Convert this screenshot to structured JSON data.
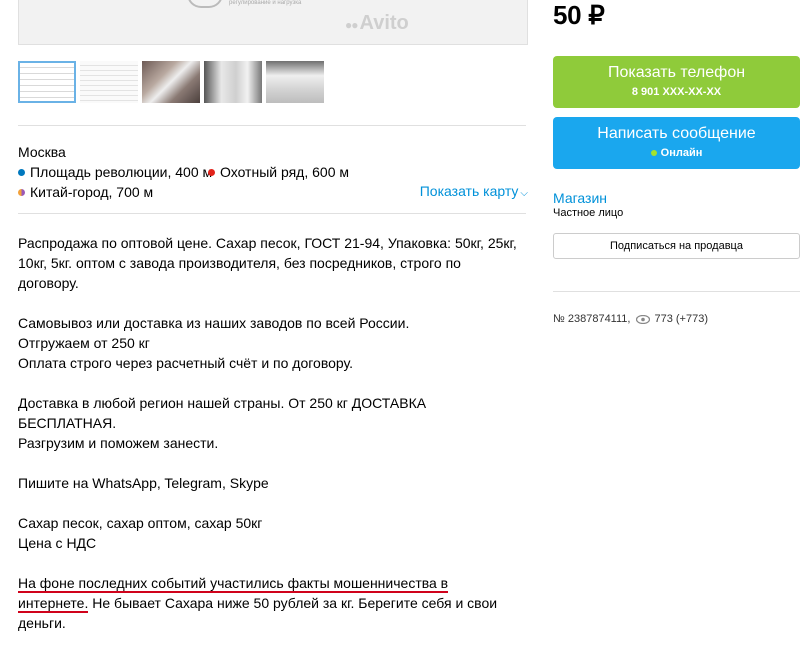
{
  "photo": {
    "watermark": "Avito",
    "caption": "регулирование и нагрузка"
  },
  "thumbnails": [
    {
      "name": "document-scan-1"
    },
    {
      "name": "document-scan-2"
    },
    {
      "name": "warehouse-sacks-1"
    },
    {
      "name": "warehouse-sacks-2"
    },
    {
      "name": "warehouse-sacks-3"
    }
  ],
  "location": {
    "city": "Москва",
    "metro": [
      {
        "label": "Площадь революции, 400 м",
        "color": "#0078be"
      },
      {
        "label": "Охотный ряд, 600 м",
        "color": "#e2231a"
      },
      {
        "label": "Китай-город, 700 м",
        "color": "multi"
      }
    ],
    "show_map": "Показать карту"
  },
  "description": {
    "p1": "Распродажа по оптовой цене. Сахар песок, ГОСТ 21-94, Упаковка: 50кг, 25кг, 10кг, 5кг. оптом с завода производителя, без посредников, строго по договору.",
    "p2_l1": "Самовывоз или доставка из наших заводов по всей России.",
    "p2_l2": "Отгружаем от 250 кг",
    "p2_l3": "Оплата строго через расчетный счёт и по договору.",
    "p3_l1": "Доставка в любой регион нашей страны. От 250 кг ДОСТАВКА БЕСПЛАТНАЯ.",
    "p3_l2": "Разгрузим и поможем занести.",
    "p4": "Пишите на WhatsApp, Telegram, Skype",
    "p5_l1": "Сахар песок, сахар оптом, сахар 50кг",
    "p5_l2": "Цена с НДС",
    "p6_underlined": "На фоне последних событий участились факты мошенничества в интернете.",
    "p6_rest": " Не бывает Сахара ниже 50 рублей за кг. Берегите себя и свои деньги."
  },
  "sidebar": {
    "price": "50 ₽",
    "phone_button": "Показать телефон",
    "phone_number": "8 901 XXX-XX-XX",
    "message_button": "Написать сообщение",
    "online": "Онлайн",
    "shop_link": "Магазин",
    "seller_type": "Частное лицо",
    "subscribe": "Подписаться на продавца",
    "ad_number": "№ 2387874111,",
    "views": "773 (+773)"
  },
  "colors": {
    "phone_button": "#8fcb3a",
    "message_button": "#1aa7ee",
    "link": "#0091d9",
    "underline": "#d0021b"
  }
}
